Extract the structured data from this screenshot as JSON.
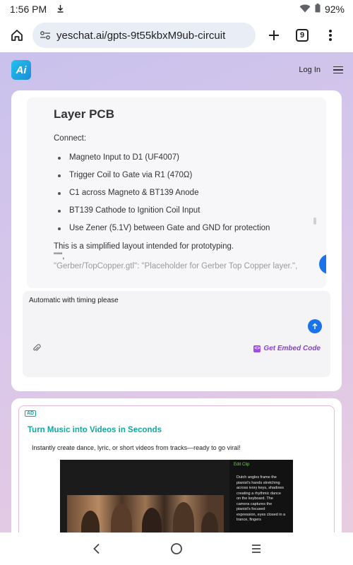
{
  "status": {
    "time": "1:56 PM",
    "battery": "92%"
  },
  "browser": {
    "url": "yeschat.ai/gpts-9t55kbxM9ub-circuit",
    "tab_count": "9"
  },
  "site": {
    "logo_text": "Ai",
    "login_label": "Log In"
  },
  "chat": {
    "heading": "Layer PCB",
    "intro": "Connect:",
    "items": [
      "Magneto Input to D1 (UF4007)",
      "Trigger Coil to Gate via R1 (470Ω)",
      "C1 across Magneto & BT139 Anode",
      "BT139 Cathode to Ignition Coil Input",
      "Use Zener (5.1V) between Gate and GND for protection"
    ],
    "note": "This is a simplified layout intended for prototyping.",
    "quote_line": "\"\"\",",
    "faded_line": "\"Gerber/TopCopper.gtl\": \"Placeholder for Gerber Top Copper layer.\",",
    "input_value": "Automatic with timing please",
    "embed_label": "Get Embed Code"
  },
  "ad": {
    "badge": "AD",
    "title": "Turn Music into Videos in Seconds",
    "description": "Instantly create dance, lyric, or short videos from tracks—ready to go viral!",
    "panel_label": "Edit Clip",
    "panel_text": "Dutch angles frame the pianist's hands stretching across ivory keys, shadows creating a rhythmic dance on the keyboard. The camera captures the pianist's focused expression, eyes closed in a trance, fingers"
  },
  "colors": {
    "accent": "#1a73e8",
    "ad_title": "#12a8a0",
    "embed": "#8a3fd1"
  }
}
